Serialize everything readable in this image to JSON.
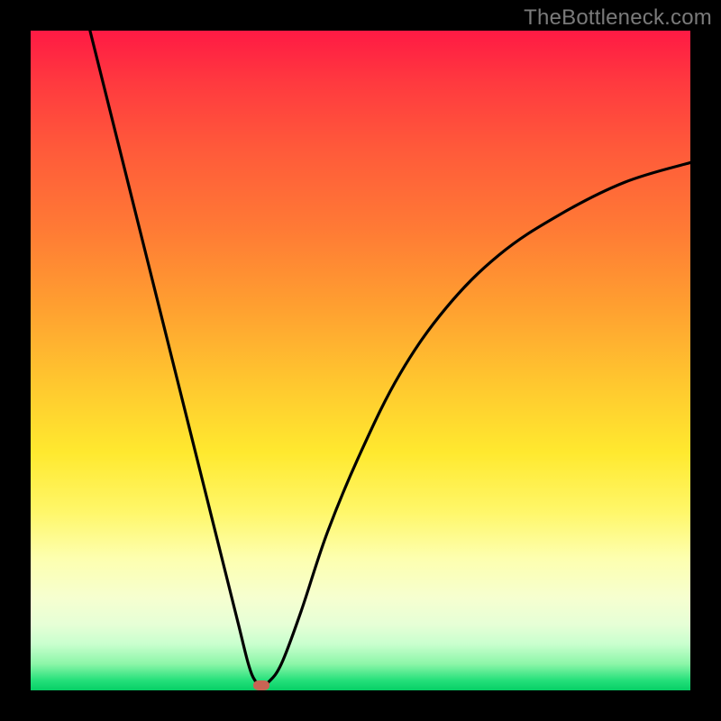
{
  "watermark": {
    "text": "TheBottleneck.com"
  },
  "colors": {
    "frame": "#000000",
    "gradient_stops": [
      "#ff1a44",
      "#ff3a3f",
      "#ff5a3a",
      "#ff7a35",
      "#ffa030",
      "#ffc92f",
      "#ffe92f",
      "#fff76a",
      "#fdffaf",
      "#f6ffd0",
      "#e6ffd6",
      "#c9ffce",
      "#8cf6a8",
      "#24e07a",
      "#06cf66"
    ],
    "curve": "#000000",
    "marker": "#c76454"
  },
  "chart_data": {
    "type": "line",
    "title": "",
    "xlabel": "",
    "ylabel": "",
    "xlim": [
      0,
      100
    ],
    "ylim": [
      0,
      100
    ],
    "legend": false,
    "grid": false,
    "series": [
      {
        "name": "curve",
        "x": [
          9,
          12,
          15,
          18,
          21,
          24,
          27,
          30,
          31.5,
          33,
          34,
          35,
          36,
          38,
          41,
          45,
          50,
          56,
          63,
          71,
          80,
          90,
          100
        ],
        "y": [
          100,
          88,
          76,
          64,
          52,
          40,
          28,
          16,
          10,
          4,
          1.5,
          0.8,
          1.2,
          4,
          12,
          24,
          36,
          48,
          58,
          66,
          72,
          77,
          80
        ]
      }
    ],
    "marker": {
      "x": 35,
      "y": 0.8,
      "shape": "rounded-rect",
      "color": "#c76454"
    },
    "notes": "Values estimated from pixel positions; axes are 0–100 normalized since no tick labels are visible."
  }
}
